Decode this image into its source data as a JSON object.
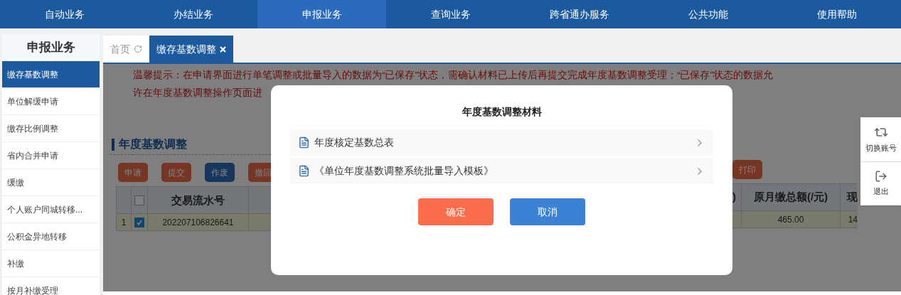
{
  "top_nav": [
    {
      "label": "自动业务",
      "selected": false
    },
    {
      "label": "办结业务",
      "selected": false
    },
    {
      "label": "申报业务",
      "selected": true
    },
    {
      "label": "查询业务",
      "selected": false
    },
    {
      "label": "跨省通办服务",
      "selected": false
    },
    {
      "label": "公共功能",
      "selected": false
    },
    {
      "label": "使用帮助",
      "selected": false
    }
  ],
  "sidebar": {
    "title": "申报业务",
    "items": [
      {
        "label": "缴存基数调整",
        "selected": true
      },
      {
        "label": "单位解缓申请",
        "selected": false
      },
      {
        "label": "缴存比例调整",
        "selected": false
      },
      {
        "label": "省内合并申请",
        "selected": false
      },
      {
        "label": "缓缴",
        "selected": false
      },
      {
        "label": "个人账户同城转移...",
        "selected": false
      },
      {
        "label": "公积金异地转移",
        "selected": false
      },
      {
        "label": "补缴",
        "selected": false
      },
      {
        "label": "按月补缴受理",
        "selected": false
      }
    ]
  },
  "tabs": [
    {
      "label": "首页",
      "selected": false,
      "kind": "home"
    },
    {
      "label": "缴存基数调整",
      "selected": true,
      "kind": "closable"
    }
  ],
  "notice": {
    "lines": [
      "温馨提示：在申请界面进行单笔调整或批量导入的数据为“已保存”状态，需确认材料已上传后再提交完成年度基数调整受理；“已保存”状态的数据允",
      "许在年度基数调整操作页面进"
    ]
  },
  "section_title": "年度基数调整",
  "toolbar_buttons": [
    {
      "label": "申请",
      "kind": "danger"
    },
    {
      "label": "提交",
      "kind": "danger"
    },
    {
      "label": "作废",
      "kind": "primary"
    },
    {
      "label": "撤回",
      "kind": "danger"
    },
    {
      "label": "打印",
      "kind": "danger"
    }
  ],
  "table": {
    "all_checked": false,
    "left_columns": [
      "交易流水号"
    ],
    "right_columns": [
      ")",
      "原月缴总额(/元)",
      "现"
    ],
    "rows": [
      {
        "number": "1",
        "checked": true,
        "left_cells": [
          "202207106826641"
        ],
        "right_cells": [
          "465.00",
          "14"
        ]
      }
    ]
  },
  "modal": {
    "title": "年度基数调整材料",
    "files": [
      "年度核定基数总表",
      "《单位年度基数调整系统批量导入模板》"
    ],
    "buttons": [
      {
        "label": "确定",
        "kind": "confirm"
      },
      {
        "label": "取消",
        "kind": "cancel"
      }
    ]
  },
  "side_panel": [
    {
      "label": "切换账号",
      "kind": "switch"
    },
    {
      "label": "退出",
      "kind": "logout"
    }
  ]
}
